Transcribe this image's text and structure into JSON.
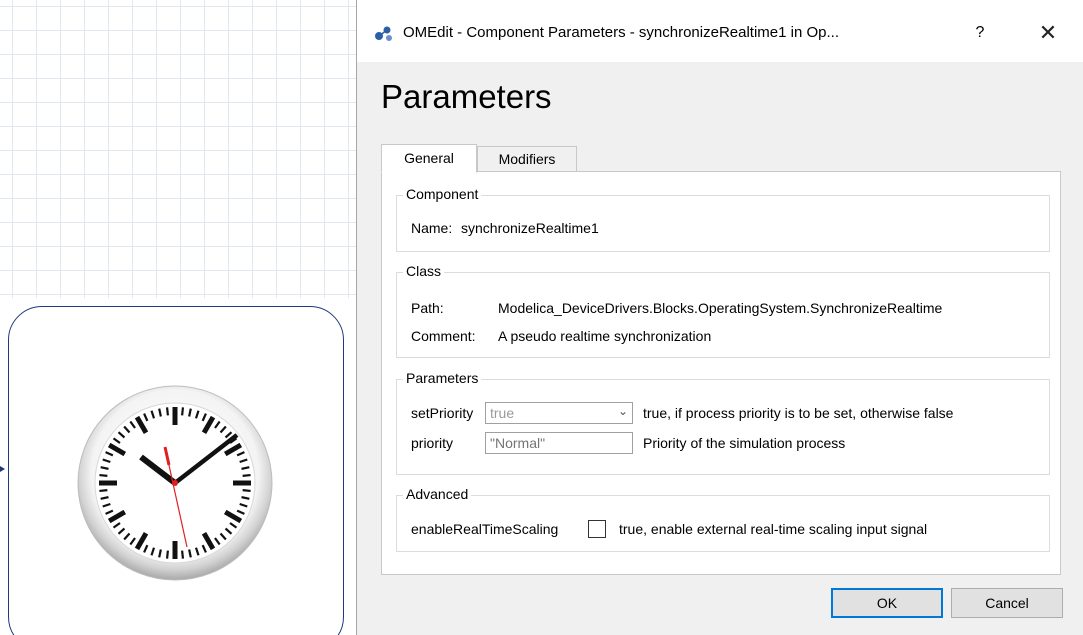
{
  "canvas": {
    "block": {
      "icon": "clock-icon"
    }
  },
  "window": {
    "title": "OMEdit - Component Parameters - synchronizeRealtime1 in Op...",
    "help_label": "?",
    "close_label": "✕",
    "icon": "omedit-app-icon"
  },
  "dialog": {
    "heading": "Parameters",
    "tabs": [
      {
        "label": "General",
        "active": true
      },
      {
        "label": "Modifiers",
        "active": false
      }
    ],
    "component": {
      "title": "Component",
      "name_label": "Name:",
      "name_value": "synchronizeRealtime1"
    },
    "class": {
      "title": "Class",
      "path_label": "Path:",
      "path_value": "Modelica_DeviceDrivers.Blocks.OperatingSystem.SynchronizeRealtime",
      "comment_label": "Comment:",
      "comment_value": "A pseudo realtime synchronization"
    },
    "parameters": {
      "title": "Parameters",
      "setPriority": {
        "label": "setPriority",
        "value": "true",
        "description": "true, if process priority is to be set, otherwise false"
      },
      "priority": {
        "label": "priority",
        "placeholder": "\"Normal\"",
        "description": "Priority of the simulation process"
      }
    },
    "advanced": {
      "title": "Advanced",
      "enableRealTimeScaling": {
        "label": "enableRealTimeScaling",
        "checked": false,
        "description": "true, enable external real-time scaling input signal"
      }
    },
    "buttons": {
      "ok_label": "OK",
      "cancel_label": "Cancel"
    }
  },
  "colors": {
    "block_border": "#1f3a7a",
    "ok_focus": "#0078d7",
    "clock_second_hand": "#e02020"
  }
}
